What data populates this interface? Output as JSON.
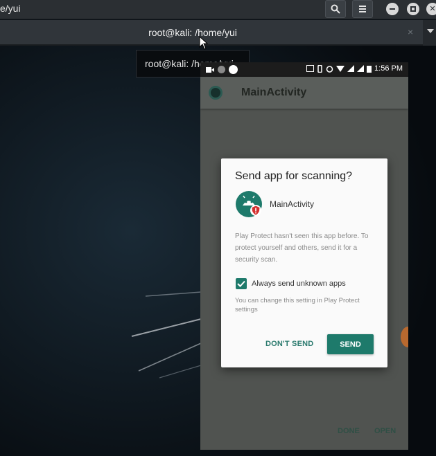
{
  "window": {
    "title": "e/yui",
    "search_icon": "search-icon",
    "menu_icon": "hamburger-menu-icon",
    "minimize_icon": "minimize-icon",
    "maximize_icon": "maximize-icon",
    "close_icon": "close-icon"
  },
  "tab": {
    "title": "root@kali: /home/yui",
    "close_symbol": "×"
  },
  "tooltip": {
    "text": "root@kali: /home/yui"
  },
  "phone": {
    "status_bar": {
      "time": "1:56 PM"
    },
    "app_bar": {
      "title": "MainActivity"
    },
    "bottom_buttons": {
      "done": "DONE",
      "open": "OPEN"
    }
  },
  "dialog": {
    "title": "Send app for scanning?",
    "app_name": "MainActivity",
    "body": "Play Protect hasn't seen this app before. To protect yourself and others, send it for a security scan.",
    "checkbox_label": "Always send unknown apps",
    "checkbox_checked": true,
    "note": "You can change this setting in Play Protect settings",
    "dont_send_label": "DON'T SEND",
    "send_label": "SEND"
  },
  "colors": {
    "accent": "#1e7a6b",
    "terminal_bg": "#0b1116",
    "titlebar": "#2b2f33"
  }
}
